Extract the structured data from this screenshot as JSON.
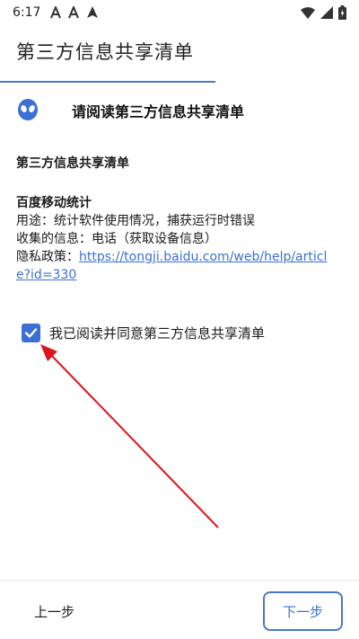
{
  "status_bar": {
    "time": "6:17",
    "left_icons": [
      "font-a-icon",
      "font-a-icon",
      "navigation-app-icon"
    ],
    "right_icons": [
      "wifi-icon",
      "signal-icon",
      "battery-charging-icon"
    ]
  },
  "app_bar": {
    "title": "第三方信息共享清单"
  },
  "header": {
    "icon": "alien-icon",
    "title": "请阅读第三方信息共享清单"
  },
  "content": {
    "section_title": "第三方信息共享清单",
    "provider": {
      "name": "百度移动统计",
      "purpose": "用途：统计软件使用情况，捕获运行时错误",
      "collected": "收集的信息：电话（获取设备信息）",
      "policy_label": "隐私政策：",
      "policy_url": "https://tongji.baidu.com/web/help/article?id=330"
    }
  },
  "consent": {
    "checked": true,
    "label": "我已阅读并同意第三方信息共享清单"
  },
  "footer": {
    "prev_label": "上一步",
    "next_label": "下一步"
  },
  "colors": {
    "accent": "#3b6fd6",
    "annotation_arrow": "#e0141e"
  }
}
